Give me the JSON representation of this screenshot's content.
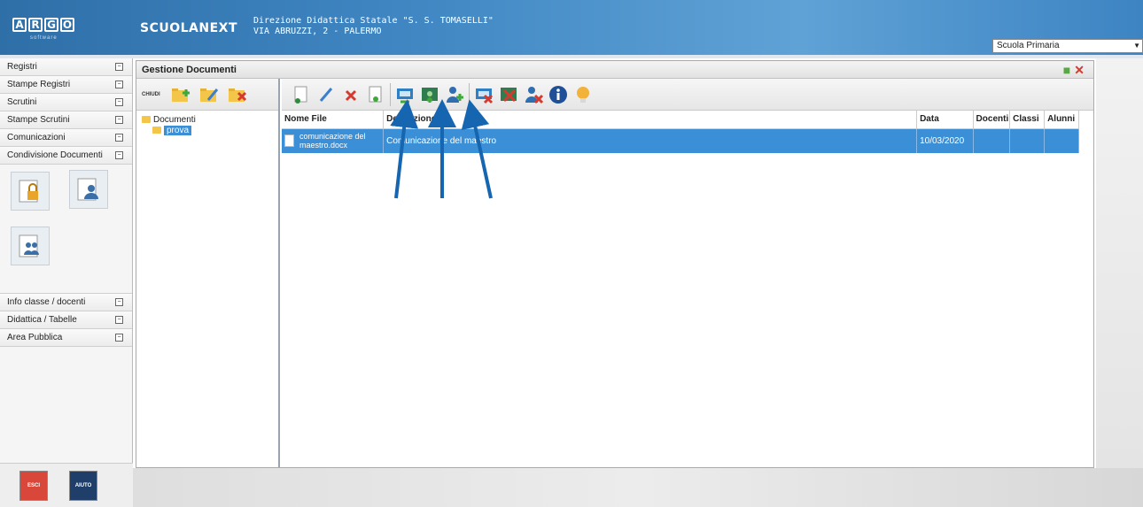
{
  "header": {
    "logo_letters": [
      "A",
      "R",
      "G",
      "O"
    ],
    "logo_sub": "software",
    "app_name": "SCUOLANEXT",
    "school_line1": "Direzione Didattica Statale \"S. S. TOMASELLI\"",
    "school_line2": "VIA ABRUZZI, 2 - PALERMO",
    "school_select": "Scuola Primaria"
  },
  "sidebar": {
    "items_top": [
      {
        "label": "Registri"
      },
      {
        "label": "Stampe Registri"
      },
      {
        "label": "Scrutini"
      },
      {
        "label": "Stampe Scrutini"
      },
      {
        "label": "Comunicazioni"
      },
      {
        "label": "Condivisione Documenti"
      }
    ],
    "items_bottom": [
      {
        "label": "Info classe / docenti"
      },
      {
        "label": "Didattica / Tabelle"
      },
      {
        "label": "Area Pubblica"
      }
    ],
    "exit_label": "ESCI",
    "help_label": "AIUTO"
  },
  "main": {
    "title": "Gestione Documenti",
    "close_label": "CHIUDI",
    "tree": {
      "root": "Documenti",
      "child": "prova"
    },
    "table": {
      "headers": [
        "Nome File",
        "Descrizione",
        "Data",
        "Docenti",
        "Classi",
        "Alunni"
      ],
      "rows": [
        {
          "file_line1": "comunicazione del",
          "file_line2": "maestro.docx",
          "description": "Comunicazione del maestro",
          "date": "10/03/2020",
          "docenti": "",
          "classi": "",
          "alunni": ""
        }
      ]
    }
  },
  "colors": {
    "accent": "#3b8fd6",
    "arrow": "#1565b0",
    "header": "#3f86c2"
  }
}
